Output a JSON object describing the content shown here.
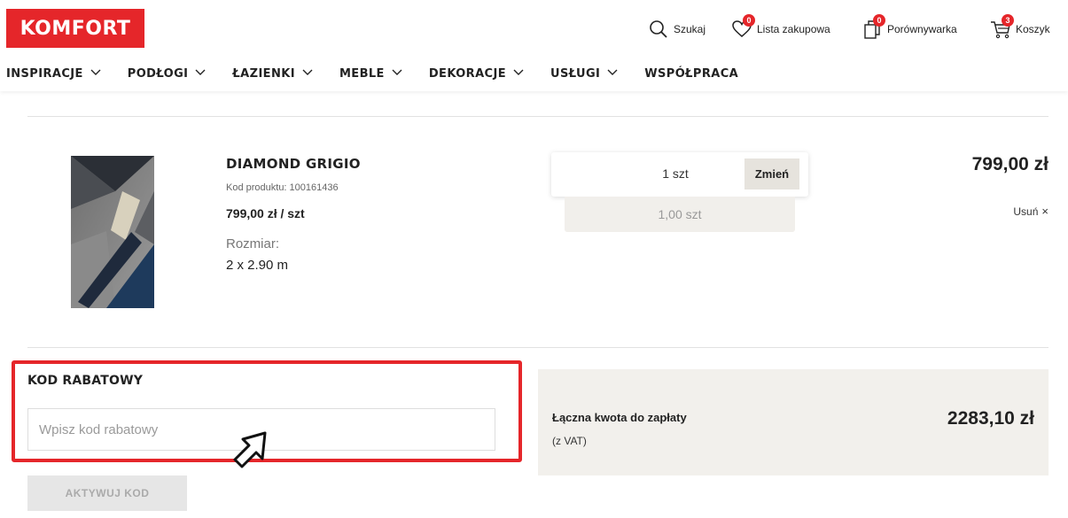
{
  "header": {
    "logo": "KOMFORT",
    "tools": [
      {
        "label": "Szukaj",
        "icon": "search-icon"
      },
      {
        "label": "Lista zakupowa",
        "icon": "heart-icon",
        "badge": "0"
      },
      {
        "label": "Porównywarka",
        "icon": "compare-icon",
        "badge": "0"
      },
      {
        "label": "Koszyk",
        "icon": "cart-icon",
        "badge": "3"
      }
    ],
    "nav": [
      {
        "label": "INSPIRACJE",
        "dropdown": true
      },
      {
        "label": "PODŁOGI",
        "dropdown": true
      },
      {
        "label": "ŁAZIENKI",
        "dropdown": true
      },
      {
        "label": "MEBLE",
        "dropdown": true
      },
      {
        "label": "DEKORACJE",
        "dropdown": true
      },
      {
        "label": "USŁUGI",
        "dropdown": true
      },
      {
        "label": "WSPÓŁPRACA",
        "dropdown": false
      }
    ]
  },
  "product": {
    "name": "DIAMOND GRIGIO",
    "code": "Kod produktu: 100161436",
    "unit_price": "799,00 zł / szt",
    "size_label": "Rozmiar:",
    "size_value": "2 x 2.90 m",
    "quantity": "1 szt",
    "change_label": "Zmień",
    "quantity_sub": "1,00 szt",
    "line_price": "799,00 zł",
    "remove_label": "Usuń",
    "remove_icon": "×"
  },
  "discount": {
    "title": "KOD RABATOWY",
    "placeholder": "Wpisz kod rabatowy",
    "value": "",
    "button": "AKTYWUJ KOD"
  },
  "total": {
    "label": "Łączna kwota do zapłaty",
    "vat": "(z VAT)",
    "value": "2283,10 zł"
  },
  "colors": {
    "brand": "#e5262a",
    "panel": "#f2f0ec",
    "button_bg": "#e6e3dd"
  }
}
